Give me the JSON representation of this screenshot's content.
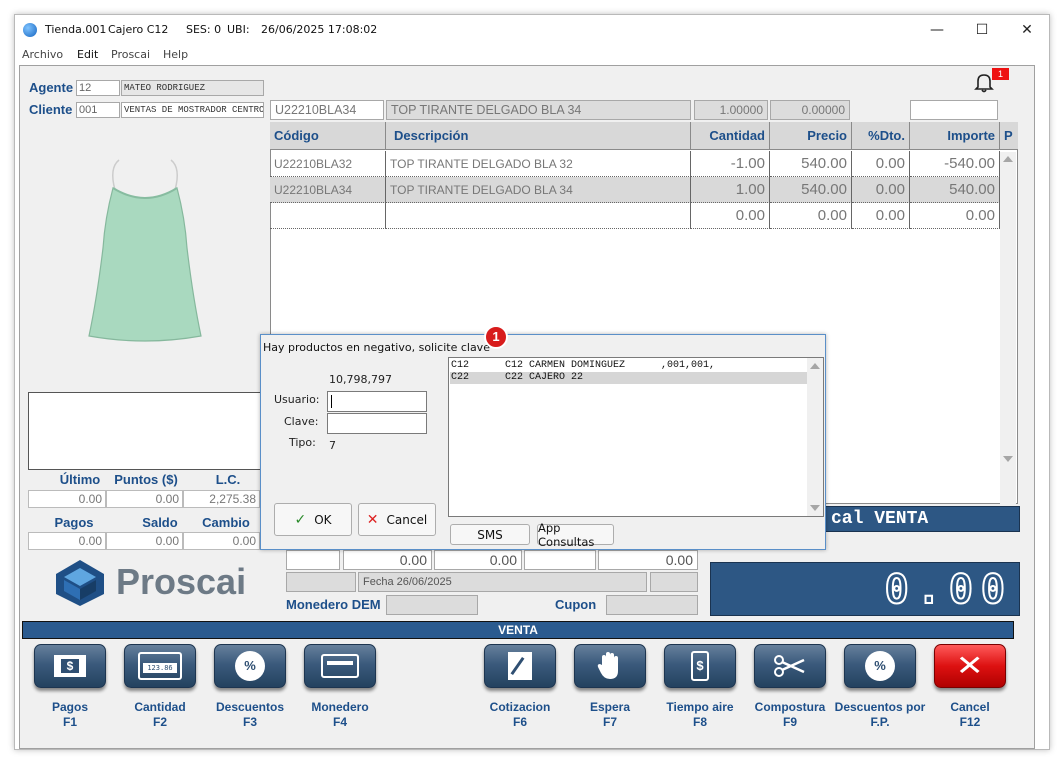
{
  "titlebar": {
    "store": "Tienda.001",
    "cashier": "Cajero C12",
    "session": "SES: 0",
    "location": "UBI:",
    "datetime": "26/06/2025 17:08:02",
    "minimize": "—",
    "maximize": "☐",
    "close": "✕"
  },
  "menu": [
    "Archivo",
    "Edit",
    "Proscai",
    "Help"
  ],
  "notification": {
    "count": "1"
  },
  "agent": {
    "label": "Agente",
    "code": "12",
    "name": "MATEO RODRIGUEZ"
  },
  "client": {
    "label": "Cliente",
    "code": "001",
    "name": "VENTAS DE MOSTRADOR CENTRO"
  },
  "entry": {
    "code": "U22210BLA34",
    "description": "TOP TIRANTE DELGADO BLA 34",
    "quantity": "1.00000",
    "price": "0.00000"
  },
  "grid": {
    "headers": [
      "Código",
      "Descripción",
      "Cantidad",
      "Precio",
      "%Dto.",
      "Importe",
      "P"
    ],
    "rows": [
      {
        "code": "U22210BLA32",
        "description": "TOP TIRANTE DELGADO BLA 32",
        "qty": "-1.00",
        "price": "540.00",
        "disc": "0.00",
        "amount": "-540.00"
      },
      {
        "code": "U22210BLA34",
        "description": "TOP TIRANTE DELGADO BLA 34",
        "qty": "1.00",
        "price": "540.00",
        "disc": "0.00",
        "amount": "540.00"
      },
      {
        "code": "",
        "description": "",
        "qty": "0.00",
        "price": "0.00",
        "disc": "0.00",
        "amount": "0.00"
      }
    ]
  },
  "stats": {
    "ultimo_label": "Último",
    "ultimo": "0.00",
    "puntos_label": "Puntos ($)",
    "puntos": "0.00",
    "lc_label": "L.C.",
    "lc": "2,275.38",
    "pagos_label": "Pagos",
    "pagos": "0.00",
    "saldo_label": "Saldo",
    "saldo": "0.00",
    "cambio_label": "Cambio",
    "cambio": "0.00"
  },
  "logo_text": "Proscai",
  "totals": {
    "v1": "0.00",
    "v2": "0.00",
    "v3": "0.00",
    "fecha": "Fecha 26/06/2025",
    "monedero_label": "Monedero DEM",
    "cupon_label": "Cupon",
    "banner": "cal VENTA",
    "total": "0.00"
  },
  "mode_bar": "VENTA",
  "dialog": {
    "badge": "1",
    "title": "Hay productos en negativo, solicite clave",
    "number": "10,798,797",
    "user_label": "Usuario:",
    "pass_label": "Clave:",
    "type_label": "Tipo:",
    "type_value": "7",
    "ok": "OK",
    "cancel": "Cancel",
    "sms": "SMS",
    "app": "App Consultas",
    "list": [
      "C12      C12 CARMEN DOMINGUEZ      ,001,001,",
      "C22      C22 CAJERO 22"
    ]
  },
  "fkeys": [
    {
      "label": "Pagos\nF1",
      "icon": "money-icon"
    },
    {
      "label": "Cantidad\nF2",
      "icon": "calculator-icon"
    },
    {
      "label": "Descuentos\nF3",
      "icon": "percent-icon"
    },
    {
      "label": "Monedero\nF4",
      "icon": "card-icon"
    },
    {
      "label": "Cotizacion\nF6",
      "icon": "quote-icon"
    },
    {
      "label": "Espera\nF7",
      "icon": "hand-icon"
    },
    {
      "label": "Tiempo aire\nF8",
      "icon": "phone-icon"
    },
    {
      "label": "Compostura\nF9",
      "icon": "scissors-icon"
    },
    {
      "label": "Descuentos por\nF.P.",
      "icon": "percent-icon"
    },
    {
      "label": "Cancel\nF12",
      "icon": "cancel-icon"
    }
  ],
  "colors": {
    "accent": "#1d4f8a",
    "bar": "#2a5a8f",
    "total_bg": "#2d5784",
    "cancel": "#dd1111"
  }
}
